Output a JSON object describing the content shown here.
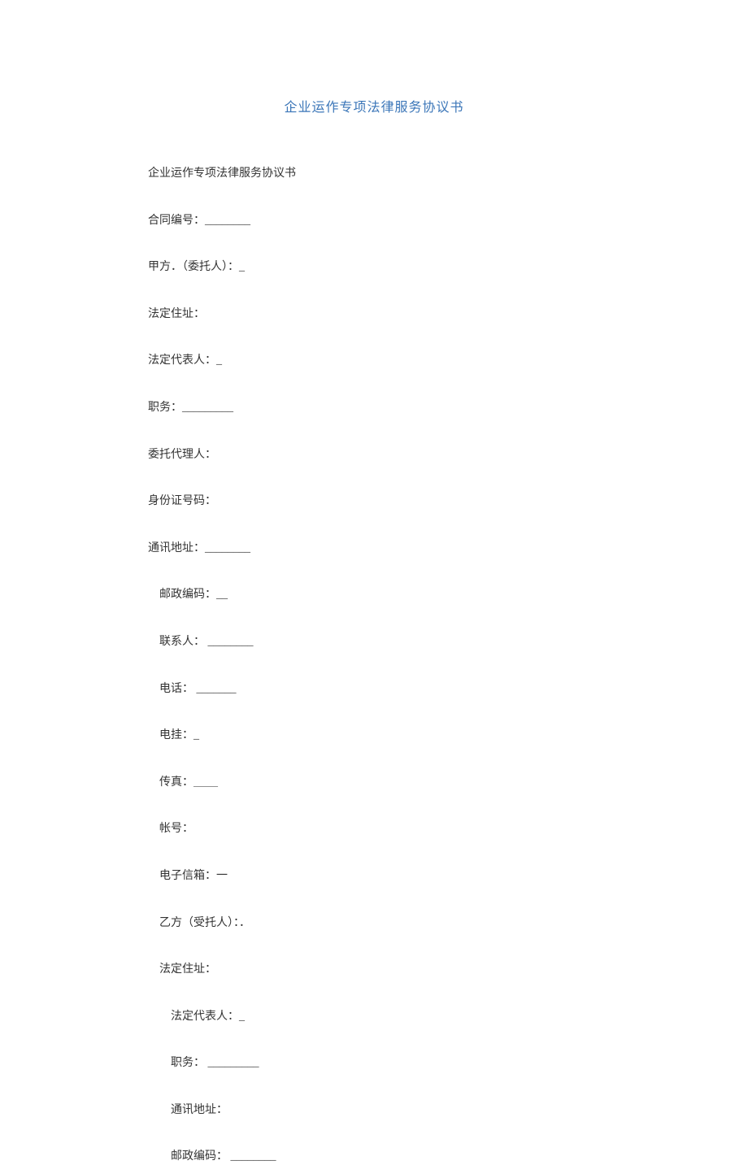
{
  "title": "企业运作专项法律服务协议书",
  "lines": [
    {
      "text": "企业运作专项法律服务协议书",
      "indent": ""
    },
    {
      "text": "合同编号：________",
      "indent": ""
    },
    {
      "text": "甲方．（委托人）：_",
      "indent": ""
    },
    {
      "text": "法定住址：",
      "indent": ""
    },
    {
      "text": "法定代表人：_",
      "indent": ""
    },
    {
      "text": "职务：_________",
      "indent": ""
    },
    {
      "text": "委托代理人：",
      "indent": ""
    },
    {
      "text": "身份证号码：",
      "indent": ""
    },
    {
      "text": "通讯地址：________",
      "indent": ""
    },
    {
      "text": "邮政编码：__",
      "indent": "indent-1"
    },
    {
      "text": "联系人：  ________",
      "indent": "indent-1"
    },
    {
      "text": "电话：  _______",
      "indent": "indent-1"
    },
    {
      "text": "电挂：_",
      "indent": "indent-1"
    },
    {
      "text": "传真：______",
      "indent": "indent-1",
      "smallUnderline": true
    },
    {
      "text": "帐号：",
      "indent": "indent-1"
    },
    {
      "text": "电子信箱：一",
      "indent": "indent-1"
    },
    {
      "text": "乙方（受托人）：．",
      "indent": "indent-1"
    },
    {
      "text": "法定住址：",
      "indent": "indent-1"
    },
    {
      "text": "法定代表人：_",
      "indent": "indent-2"
    },
    {
      "text": "职务：  _________",
      "indent": "indent-2"
    },
    {
      "text": "通讯地址：",
      "indent": "indent-2"
    },
    {
      "text": "邮政编码：  ________",
      "indent": "indent-2"
    }
  ]
}
